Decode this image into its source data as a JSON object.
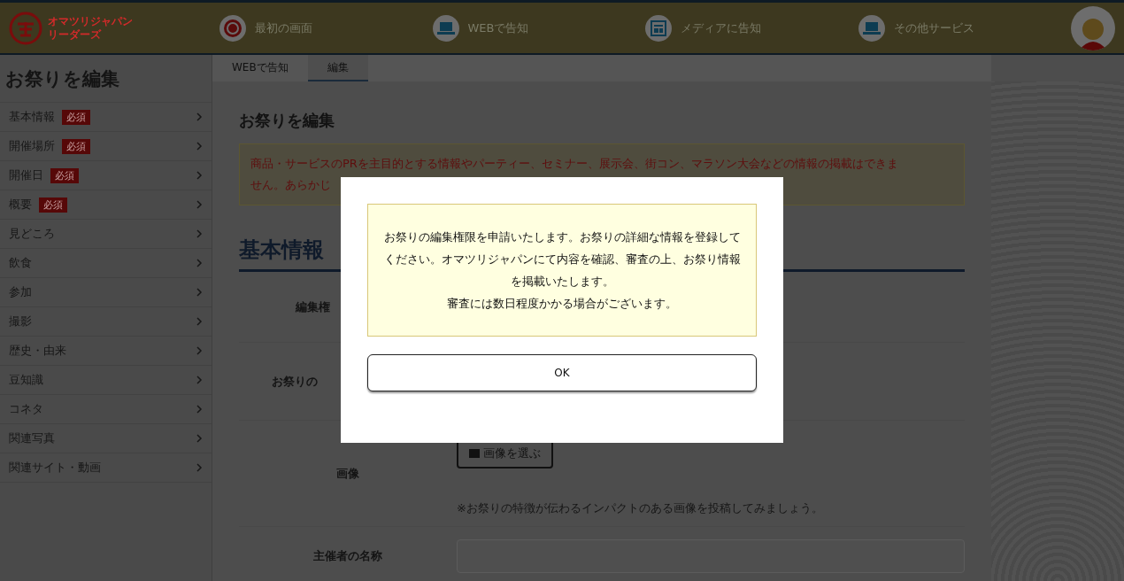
{
  "header": {
    "logo_text": [
      "オマツリジャパン",
      "リーダーズ"
    ],
    "nav": [
      {
        "kind": "festival",
        "label": "最初の画面"
      },
      {
        "kind": "laptop",
        "label": "WEBで告知"
      },
      {
        "kind": "news",
        "label": "メディアに告知"
      },
      {
        "kind": "laptop",
        "label": "その他サービス"
      }
    ]
  },
  "sidebar": {
    "title": "お祭りを編集",
    "items": [
      {
        "label": "基本情報",
        "required": true,
        "badge": "必須"
      },
      {
        "label": "開催場所",
        "required": true,
        "badge": "必須"
      },
      {
        "label": "開催日",
        "required": true,
        "badge": "必須"
      },
      {
        "label": "概要",
        "required": true,
        "badge": "必須"
      },
      {
        "label": "見どころ",
        "required": false
      },
      {
        "label": "飲食",
        "required": false
      },
      {
        "label": "参加",
        "required": false
      },
      {
        "label": "撮影",
        "required": false
      },
      {
        "label": "歴史・由来",
        "required": false
      },
      {
        "label": "豆知識",
        "required": false
      },
      {
        "label": "コネタ",
        "required": false
      },
      {
        "label": "関連写真",
        "required": false
      },
      {
        "label": "関連サイト・動画",
        "required": false
      }
    ]
  },
  "breadcrumb": [
    {
      "label": "WEBで告知",
      "selected": false
    },
    {
      "label": "編集",
      "selected": true
    }
  ],
  "page_title": "お祭りを編集",
  "notice": [
    "商品・サービスのPRを主目的とする情報やパーティー、セミナー、展示会、街コン、マラソン大会などの情報の掲載はできま",
    "せん。あらかじ"
  ],
  "section_title": "基本情報",
  "form_rows": [
    {
      "kind": "text",
      "label": "編集権"
    },
    {
      "kind": "input",
      "label": "お祭りの"
    },
    {
      "kind": "image",
      "label": "画像",
      "button": "画像を選ぶ",
      "hint": "※お祭りの特徴が伝わるインパクトのある画像を投稿してみましょう。"
    },
    {
      "kind": "input",
      "label": "主催者の名称"
    }
  ],
  "modal": {
    "message": [
      "お祭りの編集権限を申請いたします。お祭りの詳細な情報を登録してください。オマツリジャパンにて内容を確認、審査の上、お祭り情報を掲載いたします。",
      "審査には数日程度かかる場合がございます。"
    ],
    "button": "OK"
  }
}
